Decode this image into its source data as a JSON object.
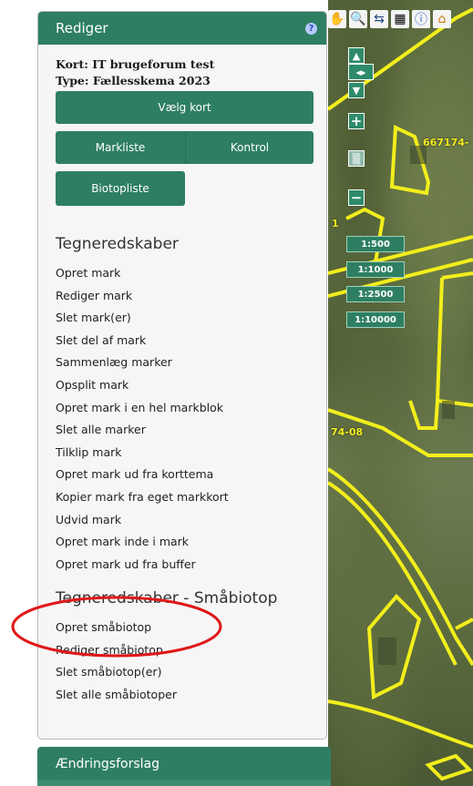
{
  "panel": {
    "title": "Rediger",
    "kort_line": "Kort: IT brugeforum test",
    "type_line": "Type: Fællesskema 2023",
    "buttons": {
      "vaelg_kort": "Vælg kort",
      "markliste": "Markliste",
      "kontrol": "Kontrol",
      "biotopliste": "Biotopliste"
    },
    "section1": {
      "heading": "Tegneredskaber",
      "items": [
        "Opret mark",
        "Rediger mark",
        "Slet mark(er)",
        "Slet del af mark",
        "Sammenlæg marker",
        "Opsplit mark",
        "Opret mark i en hel markblok",
        "Slet alle marker",
        "Tilklip mark",
        "Opret mark ud fra korttema",
        "Kopier mark fra eget markkort",
        "Udvid mark",
        "Opret mark inde i mark",
        "Opret mark ud fra buffer"
      ]
    },
    "section2": {
      "heading": "Tegneredskaber - Småbiotop",
      "items": [
        "Opret småbiotop",
        "Rediger småbiotop",
        "Slet småbiotop(er)",
        "Slet alle småbiotoper"
      ]
    }
  },
  "bottom": {
    "aendringsforslag": "Ændringsforslag"
  },
  "map": {
    "scales": [
      "1:500",
      "1:1000",
      "1:2500",
      "1:10000"
    ],
    "labels": {
      "top_right": "667174-",
      "mid_left": "74-08",
      "edge": "1"
    },
    "toolbar_icons": [
      "pan-hand-icon",
      "zoom-icon",
      "measure-icon",
      "print-icon",
      "info-icon",
      "home-icon"
    ]
  },
  "colors": {
    "accent": "#2e7f62",
    "field_outline": "#f2ee1c",
    "highlight_circle": "#e01818"
  }
}
